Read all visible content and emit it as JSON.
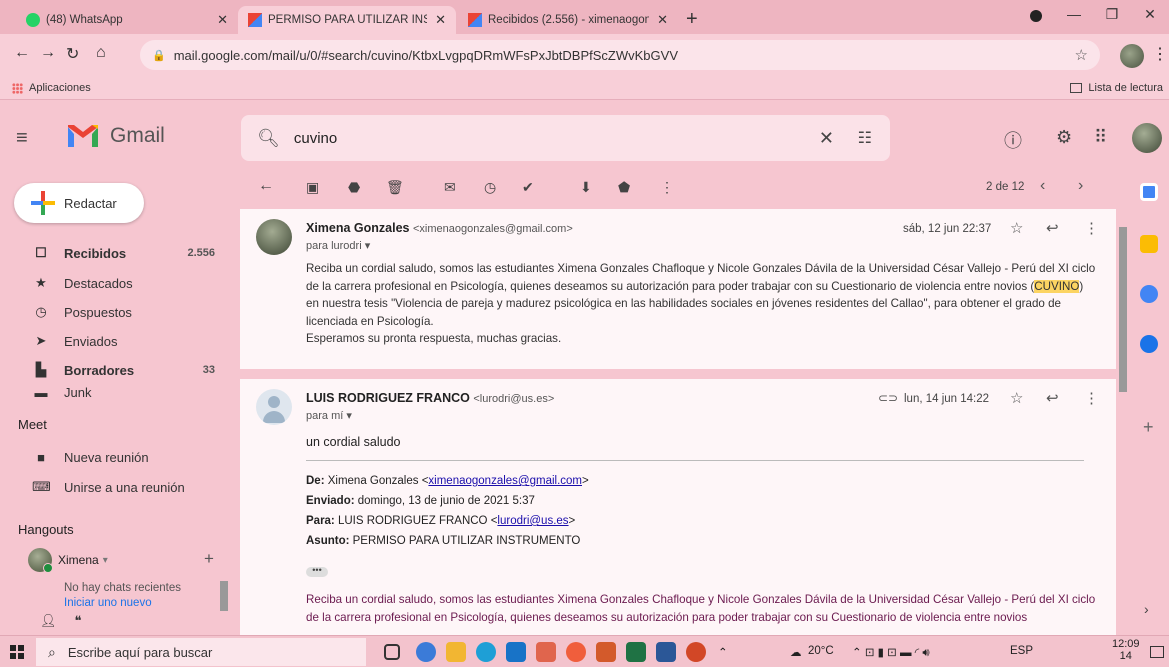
{
  "browser": {
    "tabs": [
      {
        "label": "(48) WhatsApp",
        "active": false
      },
      {
        "label": "PERMISO PARA UTILIZAR INSTRU",
        "active": true
      },
      {
        "label": "Recibidos (2.556) - ximenaogonz",
        "active": false
      }
    ],
    "url": "mail.google.com/mail/u/0/#search/cuvino/KtbxLvgpqDRmWFsPxJbtDBPfScZWvKbGVV",
    "bookmarks": {
      "apps": "Aplicaciones",
      "reading_list": "Lista de lectura"
    }
  },
  "gmail": {
    "brand": "Gmail",
    "search_value": "cuvino",
    "compose_label": "Redactar",
    "nav": [
      {
        "label": "Recibidos",
        "count": "2.556",
        "bold": true,
        "icon": "inbox-icon"
      },
      {
        "label": "Destacados",
        "count": "",
        "bold": false,
        "icon": "star-icon"
      },
      {
        "label": "Pospuestos",
        "count": "",
        "bold": false,
        "icon": "clock-icon"
      },
      {
        "label": "Enviados",
        "count": "",
        "bold": false,
        "icon": "send-icon"
      },
      {
        "label": "Borradores",
        "count": "33",
        "bold": true,
        "icon": "draft-icon"
      },
      {
        "label": "Junk",
        "count": "",
        "bold": false,
        "icon": "label-icon"
      }
    ],
    "meet": {
      "title": "Meet",
      "new_meeting": "Nueva reunión",
      "join_meeting": "Unirse a una reunión"
    },
    "hangouts": {
      "title": "Hangouts",
      "user": "Ximena",
      "no_chats": "No hay chats recientes",
      "start_new": "Iniciar uno nuevo"
    },
    "pager": "2 de 12"
  },
  "messages": [
    {
      "sender_name": "Ximena Gonzales",
      "sender_email": "<ximenaogonzales@gmail.com>",
      "to": "para lurodri",
      "date": "sáb, 12 jun 22:37",
      "body_pre": "Reciba un cordial saludo, somos las estudiantes Ximena Gonzales Chafloque y Nicole Gonzales Dávila de la Universidad César Vallejo - Perú del XI ciclo de la carrera profesional en Psicología, quienes deseamos su autorización para poder trabajar con su Cuestionario de violencia entre novios (",
      "highlight": "CUVINO",
      "body_post": ") en nuestra tesis \"Violencia de pareja y madurez psicológica en las habilidades sociales en jóvenes residentes del Callao\", para obtener el grado de licenciada en Psicología.",
      "closing": "Esperamos su pronta respuesta, muchas gracias."
    },
    {
      "sender_name": "LUIS RODRIGUEZ FRANCO",
      "sender_email": "<lurodri@us.es>",
      "to": "para mí",
      "date": "lun, 14 jun 14:22",
      "greeting": "un cordial saludo",
      "quoted": {
        "from_label": "De:",
        "from_name": "Ximena Gonzales <",
        "from_email": "ximenaogonzales@gmail.com",
        "from_end": ">",
        "sent_label": "Enviado:",
        "sent_value": "domingo, 13 de junio de 2021 5:37",
        "to_label": "Para:",
        "to_name": "LUIS RODRIGUEZ FRANCO <",
        "to_email": "lurodri@us.es",
        "to_end": ">",
        "subject_label": "Asunto:",
        "subject_value": "PERMISO PARA UTILIZAR INSTRUMENTO",
        "ellipsis": "•••",
        "body": "Reciba un cordial saludo, somos las estudiantes Ximena Gonzales Chafloque y Nicole Gonzales Dávila de la Universidad César Vallejo - Perú del XI ciclo de la carrera profesional en Psicología, quienes deseamos su autorización para poder trabajar con su Cuestionario de violencia entre novios"
      }
    }
  ],
  "taskbar": {
    "search_placeholder": "Escribe aquí para buscar",
    "weather": "20°C",
    "language": "ESP",
    "time": "12:09",
    "date_partial": "14"
  },
  "colors": {
    "pink_bg": "#f6c6d0",
    "highlight": "#fcd462",
    "gmail_red": "#ea4335"
  }
}
